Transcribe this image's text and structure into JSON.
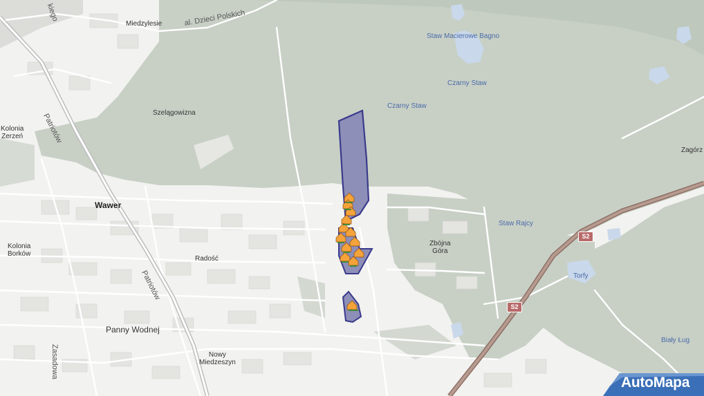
{
  "map": {
    "colors": {
      "forest": "#c8d0c6",
      "background": "#f2f2f0",
      "road": "#ffffff",
      "expressway": "#a88a7f",
      "water": "#c9d8ea",
      "area_fill": "#8d8fb8",
      "area_border": "#3a3a8c",
      "logo_blue": "#3b6fb7"
    },
    "labels": {
      "miedzylesie": "Miedzylesie",
      "dzieci_polskich": "al. Dzieci Polskich",
      "kiego": "kiego",
      "staw_macierowe": "Staw Macierowe Bagno",
      "czarny_staw_1": "Czarny Staw",
      "czarny_staw_2": "Czarny Staw",
      "szelagowizna": "Szelągowizna",
      "kolonia_zerzen": "Kolonia\nZerzeń",
      "patriotow_1": "Patriotów",
      "patriotow_2": "Patriotów",
      "wawer": "Wawer",
      "kolonia_borkow": "Kolonia\nBorków",
      "radosc": "Radość",
      "zbojna_gora": "Zbójna\nGóra",
      "staw_rajcy": "Staw Rajcy",
      "torfy": "Torfy",
      "zagorz": "Zagórz",
      "panny_wodnej": "Panny Wodnej",
      "zasadowa": "Zasadowa",
      "nowy_miedzeszyn": "Nowy\nMiedzeszyn",
      "bialy_lug": "Biały Ług"
    },
    "road_shields": [
      "S2",
      "S2"
    ],
    "logo": "AutoMapa",
    "icons": [
      "house-marker-icon"
    ]
  }
}
